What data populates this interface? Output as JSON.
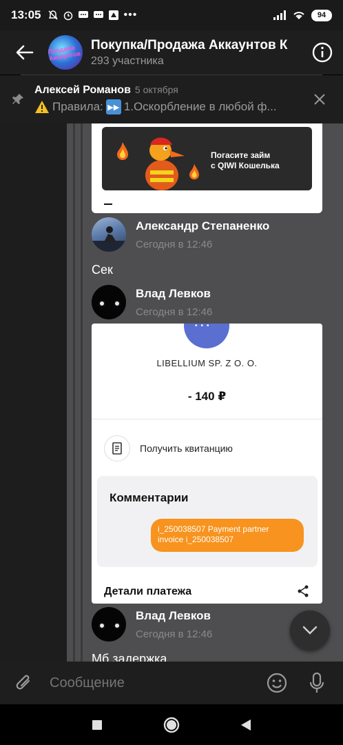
{
  "status": {
    "time": "13:05",
    "battery": "94"
  },
  "header": {
    "title": "Покупка/Продажа Аккаунтов К",
    "subtitle": "293 участника",
    "avatar_text": "Продажа Аккаунтов"
  },
  "pinned": {
    "author": "Алексей Романов",
    "date": "5 октября",
    "label": "Правила:",
    "text": "1.Оскорбление в любой ф..."
  },
  "ad": {
    "line1": "Погасите займ",
    "line2": "с QIWI Кошелька"
  },
  "messages": [
    {
      "name": "Александр Степаненко",
      "time": "Сегодня в 12:46",
      "text": "Сек"
    },
    {
      "name": "Влад Левков",
      "time": "Сегодня в 12:46"
    },
    {
      "name": "Влад Левков",
      "time": "Сегодня в 12:46",
      "text": "Мб задержка"
    }
  ],
  "receipt": {
    "company": "LIBELLIUM SP. Z O. O.",
    "amount": "- 140 ₽",
    "get_receipt": "Получить квитанцию",
    "comments_title": "Комментарии",
    "comment_line1": "i_250038507 Payment partner",
    "comment_line2": "invoice i_250038507",
    "details_title": "Детали платежа"
  },
  "input": {
    "placeholder": "Сообщение"
  },
  "colors": {
    "accent_orange": "#f7931e",
    "chat_bg": "#4e4e50",
    "bar_bg": "#1e1e1e"
  }
}
